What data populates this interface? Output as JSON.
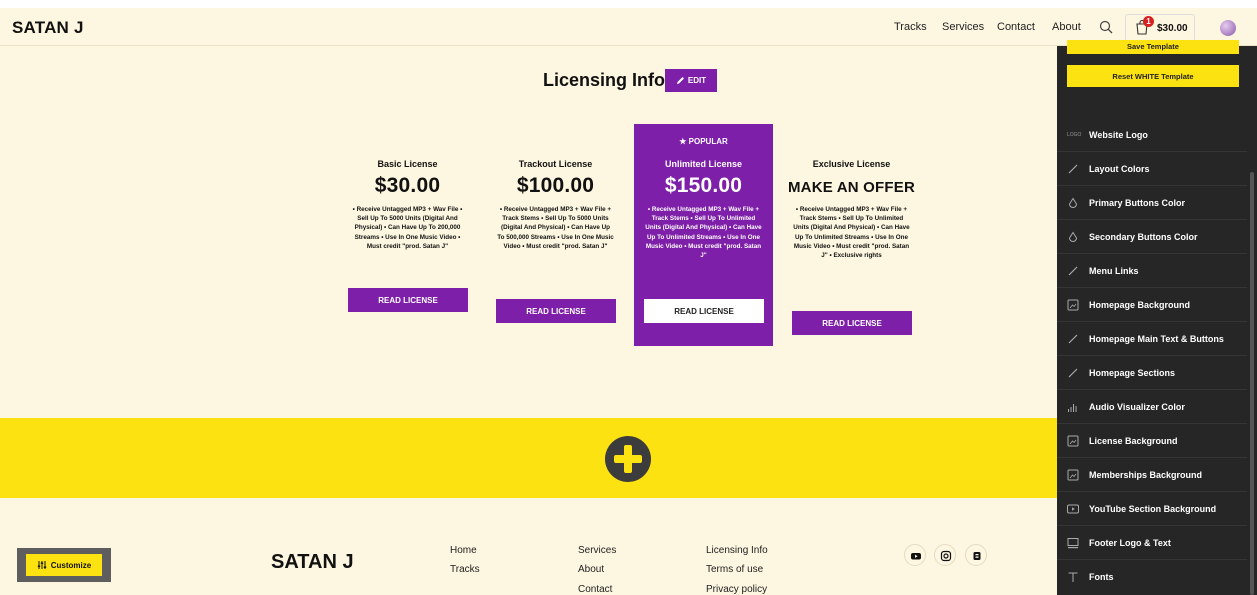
{
  "header": {
    "brand": "SATAN J",
    "nav": [
      "Tracks",
      "Services",
      "Contact",
      "About"
    ],
    "cart_count": "1",
    "cart_total": "$30.00"
  },
  "licensing": {
    "title": "Licensing Info",
    "edit_label": "EDIT",
    "popular_label": "POPULAR",
    "cards": [
      {
        "name": "Basic License",
        "price": "$30.00",
        "desc": "• Receive Untagged MP3 + Wav File • Sell Up To 5000 Units (Digital And Physical) • Can Have Up To 200,000 Streams • Use In One Music Video • Must credit \"prod. Satan J\"",
        "button": "READ LICENSE"
      },
      {
        "name": "Trackout License",
        "price": "$100.00",
        "desc": "• Receive Untagged MP3 + Wav File + Track Stems • Sell Up To 5000 Units (Digital And Physical) • Can Have Up To 500,000 Streams • Use In One Music Video • Must credit \"prod. Satan J\"",
        "button": "READ LICENSE"
      },
      {
        "name": "Unlimited License",
        "price": "$150.00",
        "desc": "• Receive Untagged MP3 + Wav File + Track Stems • Sell Up To Unlimited Units (Digital And Physical) • Can Have Up To Unlimited Streams • Use In One Music Video • Must credit \"prod. Satan J\"",
        "button": "READ LICENSE"
      },
      {
        "name": "Exclusive License",
        "price": "MAKE AN OFFER",
        "desc": "• Receive Untagged MP3 + Wav File + Track Stems • Sell Up To Unlimited Units (Digital And Physical) • Can Have Up To Unlimited Streams • Use In One Music Video • Must credit \"prod. Satan J\" • Exclusive rights",
        "button": "READ LICENSE"
      }
    ]
  },
  "footer": {
    "brand": "SATAN J",
    "col1": [
      "Home",
      "Tracks"
    ],
    "col2": [
      "Services",
      "About",
      "Contact"
    ],
    "col3": [
      "Licensing Info",
      "Terms of use",
      "Privacy policy"
    ],
    "social_icons": [
      "youtube-icon",
      "instagram-icon",
      "beatstars-icon"
    ]
  },
  "customize": {
    "label": "Customize"
  },
  "panel": {
    "save_template": "Save Template",
    "reset_template": "Reset WHITE Template",
    "logo_tag": "LOGO",
    "items": [
      {
        "label": "Website Logo",
        "icon": "logo-icon"
      },
      {
        "label": "Layout Colors",
        "icon": "brush-icon"
      },
      {
        "label": "Primary Buttons Color",
        "icon": "drop-icon"
      },
      {
        "label": "Secondary Buttons Color",
        "icon": "drop-icon"
      },
      {
        "label": "Menu Links",
        "icon": "brush-icon"
      },
      {
        "label": "Homepage Background",
        "icon": "image-icon"
      },
      {
        "label": "Homepage Main Text & Buttons",
        "icon": "brush-icon"
      },
      {
        "label": "Homepage Sections",
        "icon": "brush-icon"
      },
      {
        "label": "Audio Visualizer Color",
        "icon": "bars-icon"
      },
      {
        "label": "License Background",
        "icon": "image-icon"
      },
      {
        "label": "Memberships Background",
        "icon": "image-icon"
      },
      {
        "label": "YouTube Section Background",
        "icon": "play-icon"
      },
      {
        "label": "Footer Logo & Text",
        "icon": "monitor-icon"
      },
      {
        "label": "Fonts",
        "icon": "text-icon"
      }
    ]
  }
}
